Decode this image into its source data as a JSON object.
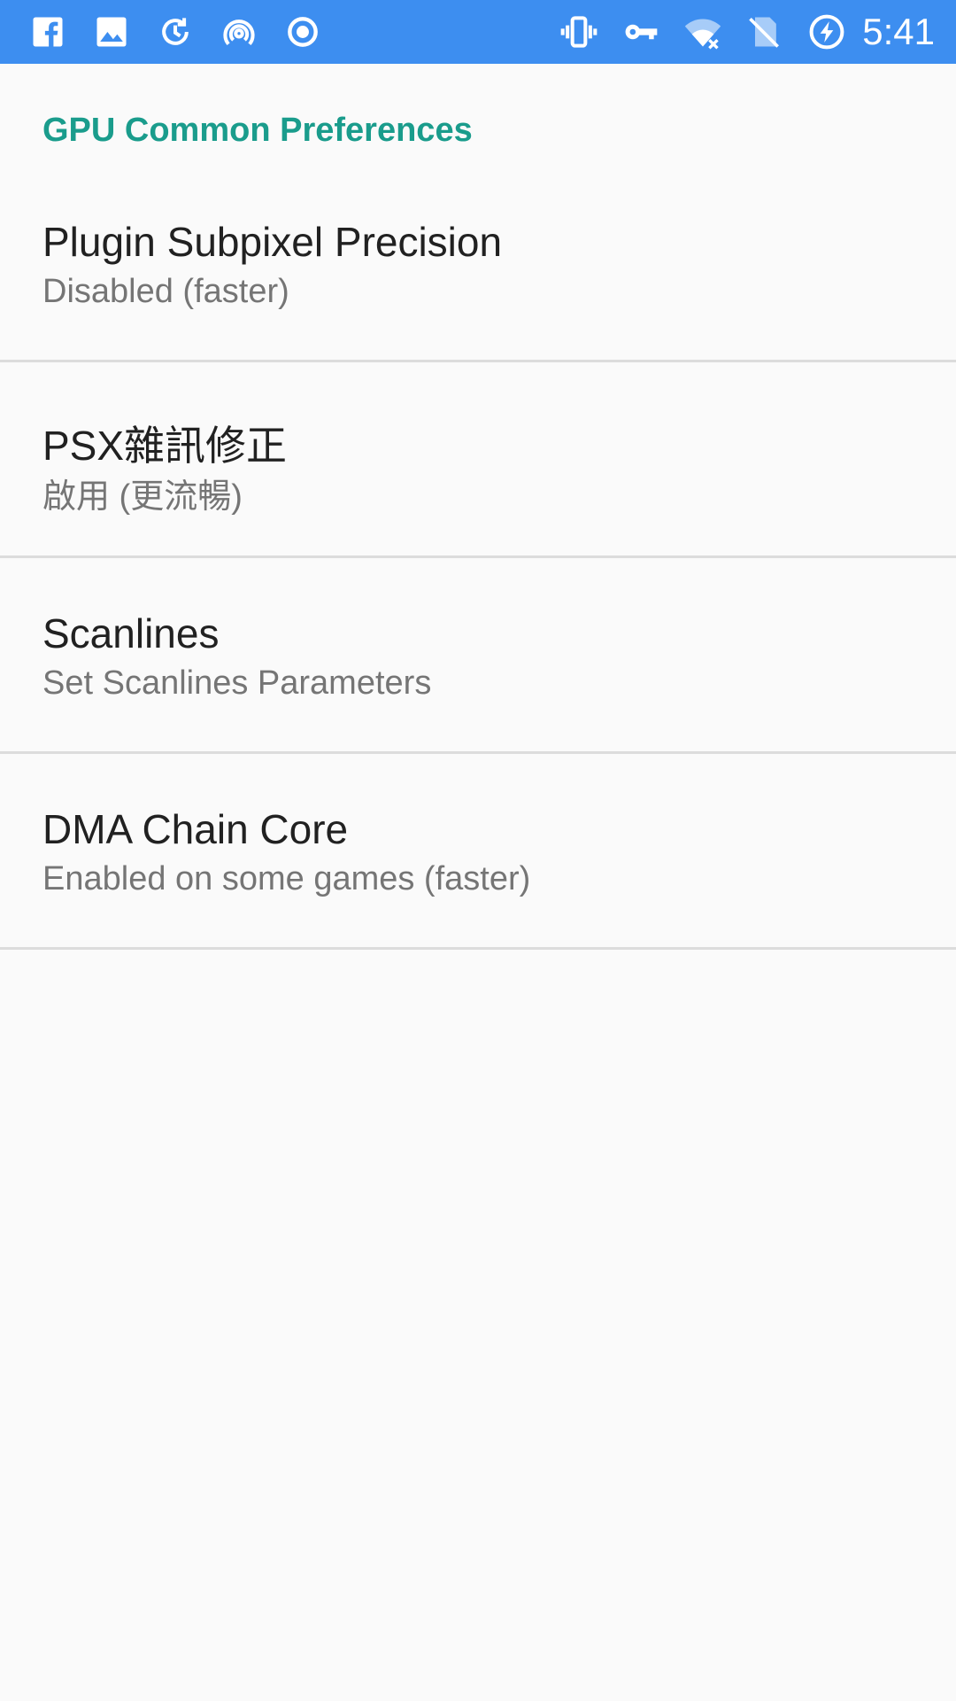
{
  "status_bar": {
    "time": "5:41",
    "left_icons": [
      "facebook-icon",
      "image-icon",
      "sync-icon",
      "hotspot-icon",
      "record-icon"
    ],
    "right_icons": [
      "vibrate-icon",
      "vpn-key-icon",
      "wifi-icon",
      "no-sim-icon",
      "battery-charging-icon"
    ]
  },
  "category": {
    "title": "GPU Common Preferences"
  },
  "preferences": [
    {
      "title": "Plugin Subpixel Precision",
      "summary": "Disabled (faster)"
    },
    {
      "title": "PSX雜訊修正",
      "summary": "啟用 (更流暢)"
    },
    {
      "title": "Scanlines",
      "summary": "Set Scanlines Parameters"
    },
    {
      "title": "DMA Chain Core",
      "summary": "Enabled on some games (faster)"
    }
  ],
  "colors": {
    "status_bar": "#3d8ef0",
    "accent": "#1a9c8c",
    "background": "#fafafa",
    "divider": "#dcdcdc"
  }
}
